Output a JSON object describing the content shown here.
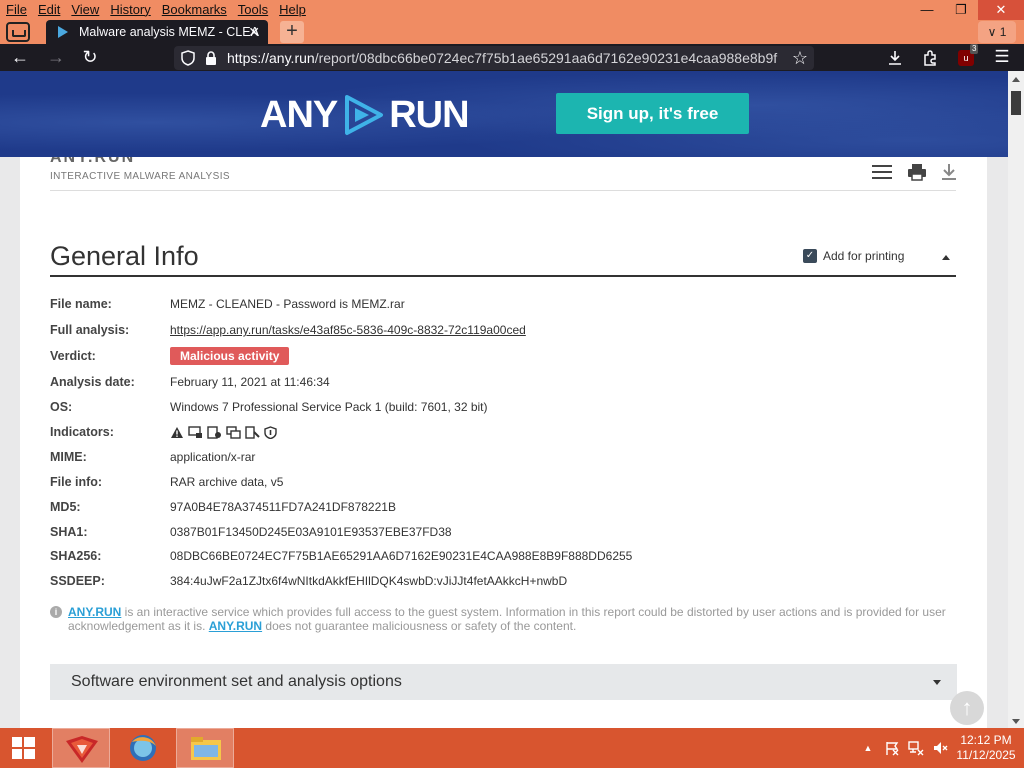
{
  "browser": {
    "menu": [
      "File",
      "Edit",
      "View",
      "History",
      "Bookmarks",
      "Tools",
      "Help"
    ],
    "tab_title": "Malware analysis MEMZ - CLEA",
    "tab_count": "1",
    "url_host": "https://any.run",
    "url_path": "/report/08dbc66be0724ec7f75b1ae65291aa6d7162e90231e4caa988e8b9f",
    "ublock_count": "3"
  },
  "banner": {
    "logo_left": "ANY",
    "logo_right": "RUN",
    "signup_label": "Sign up, it's free"
  },
  "header": {
    "brand_top": "ANY.RUN",
    "brand_tagline": "INTERACTIVE MALWARE ANALYSIS"
  },
  "general_info": {
    "title": "General Info",
    "add_printing_label": "Add for printing",
    "rows": [
      {
        "key": "File name:",
        "value": "MEMZ - CLEANED - Password is MEMZ.rar"
      },
      {
        "key": "Full analysis:",
        "value": "https://app.any.run/tasks/e43af85c-5836-409c-8832-72c119a00ced"
      },
      {
        "key": "Verdict:",
        "value": "Malicious activity"
      },
      {
        "key": "Analysis date:",
        "value": "February 11, 2021 at 11:46:34"
      },
      {
        "key": "OS:",
        "value": "Windows 7 Professional Service Pack 1 (build: 7601, 32 bit)"
      },
      {
        "key": "Indicators:",
        "value": ""
      },
      {
        "key": "MIME:",
        "value": "application/x-rar"
      },
      {
        "key": "File info:",
        "value": "RAR archive data, v5"
      },
      {
        "key": "MD5:",
        "value": "97A0B4E78A374511FD7A241DF878221B"
      },
      {
        "key": "SHA1:",
        "value": "0387B01F13450D245E03A9101E93537EBE37FD38"
      },
      {
        "key": "SHA256:",
        "value": "08DBC66BE0724EC7F75B1AE65291AA6D7162E90231E4CAA988E8B9F888DD6255"
      },
      {
        "key": "SSDEEP:",
        "value": "384:4uJwF2a1ZJtx6f4wNItkdAkkfEHIlDQK4swbD:vJiJJt4fetAAkkcH+nwbD"
      }
    ],
    "verdict_color": "#e05a5a",
    "note_link": "ANY.RUN",
    "note_text_1": " is an interactive service which provides full access to the guest system. Information in this report could be distorted by user actions and is provided for user acknowledgement as it is. ",
    "note_text_2": " does not guarantee maliciousness or safety of the content."
  },
  "section2": {
    "title": "Software environment set and analysis options"
  },
  "taskbar": {
    "time": "12:12 PM",
    "date": "11/12/2025"
  },
  "colors": {
    "accent_teal": "#1cb5b0",
    "banner_blue": "#1f3a8a",
    "taskbar": "#d8552f",
    "titlebar": "#f08c63"
  }
}
